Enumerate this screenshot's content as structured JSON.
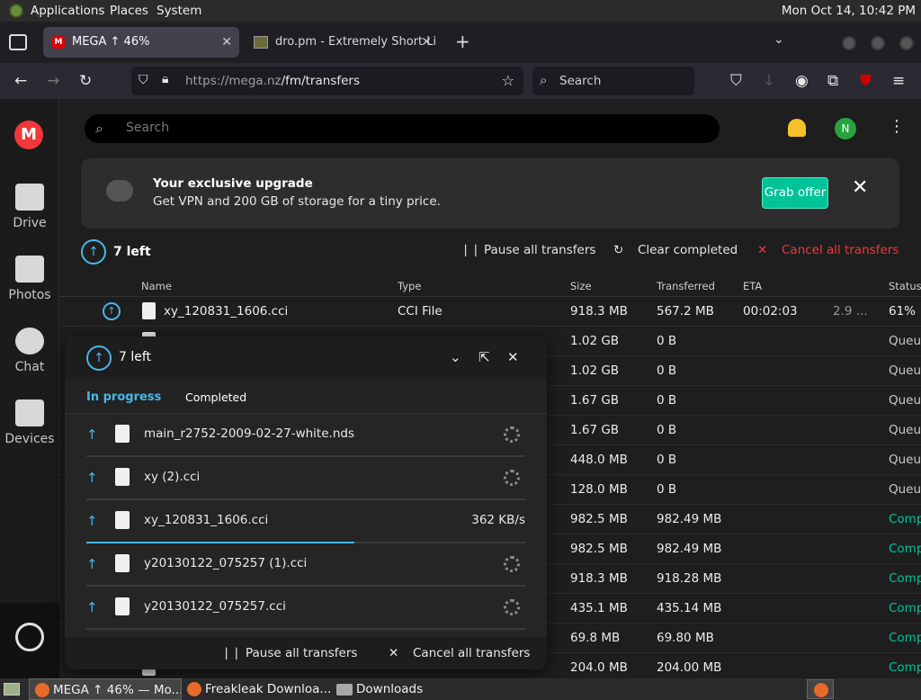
{
  "topbar": {
    "menus": [
      "Applications",
      "Places",
      "System"
    ],
    "clock": "Mon Oct 14, 10:42 PM"
  },
  "browser": {
    "tabs": [
      {
        "title": "MEGA ↑ 46%",
        "favicon": "M"
      },
      {
        "title": "dro.pm - Extremely Short Li"
      }
    ],
    "url_host": "https://mega.nz",
    "url_path": "/fm/transfers",
    "search_placeholder": "Search"
  },
  "sidebar": {
    "logo": "M",
    "items": [
      "Drive",
      "Photos",
      "Chat",
      "Devices"
    ]
  },
  "main": {
    "search_placeholder": "Search",
    "avatar_initial": "N",
    "banner": {
      "title": "Your exclusive upgrade",
      "text": "Get VPN and 200 GB of storage for a tiny price.",
      "button": "Grab offer"
    },
    "left_count": "7 left",
    "actions": {
      "pause": "Pause all transfers",
      "clear": "Clear completed",
      "cancel": "Cancel all transfers"
    },
    "columns": {
      "name": "Name",
      "type": "Type",
      "size": "Size",
      "transferred": "Transferred",
      "eta": "ETA",
      "status": "Status"
    },
    "rows": [
      {
        "name": "xy_120831_1606.cci",
        "type": "CCI File",
        "size": "918.3 MB",
        "transferred": "567.2 MB",
        "eta": "00:02:03",
        "speed": "2.9 ...",
        "status": "61%"
      },
      {
        "size": "1.02 GB",
        "transferred": "0 B",
        "status": "Queu"
      },
      {
        "size": "1.02 GB",
        "transferred": "0 B",
        "status": "Queu"
      },
      {
        "size": "1.67 GB",
        "transferred": "0 B",
        "status": "Queu"
      },
      {
        "size": "1.67 GB",
        "transferred": "0 B",
        "status": "Queu"
      },
      {
        "size": "448.0 MB",
        "transferred": "0 B",
        "status": "Queu"
      },
      {
        "size": "128.0 MB",
        "transferred": "0 B",
        "status": "Queu"
      },
      {
        "size": "982.5 MB",
        "transferred": "982.49 MB",
        "status": "Comp"
      },
      {
        "size": "982.5 MB",
        "transferred": "982.49 MB",
        "status": "Comp"
      },
      {
        "size": "918.3 MB",
        "transferred": "918.28 MB",
        "status": "Comp"
      },
      {
        "size": "435.1 MB",
        "transferred": "435.14 MB",
        "status": "Comp"
      },
      {
        "size": "69.8 MB",
        "transferred": "69.80 MB",
        "status": "Comp"
      },
      {
        "size": "204.0 MB",
        "transferred": "204.00 MB",
        "status": "Comp"
      }
    ]
  },
  "overlay": {
    "count": "7 left",
    "tabs": {
      "progress": "In progress",
      "completed": "Completed"
    },
    "items": [
      {
        "name": "main_r2752-2009-02-27-white.nds",
        "speed": ""
      },
      {
        "name": "xy (2).cci",
        "speed": ""
      },
      {
        "name": "xy_120831_1606.cci",
        "speed": "362 KB/s",
        "progress": 0.61
      },
      {
        "name": "y20130122_075257 (1).cci",
        "speed": ""
      },
      {
        "name": "y20130122_075257.cci",
        "speed": ""
      }
    ],
    "footer": {
      "pause": "Pause all transfers",
      "cancel": "Cancel all transfers"
    }
  },
  "taskbar": {
    "items": [
      "MEGA ↑ 46% — Mo...",
      "Freakleak Downloa...",
      "Downloads"
    ]
  },
  "colors": {
    "accent_blue": "#4ab5e8",
    "mega_red": "#f0373a",
    "complete_green": "#00c398"
  }
}
